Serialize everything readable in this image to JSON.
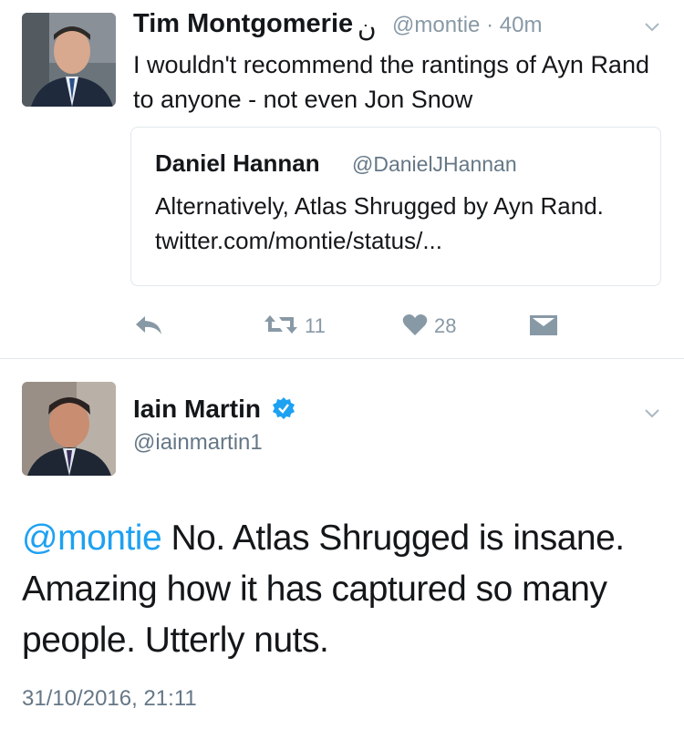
{
  "tweet1": {
    "author_name": "Tim Montgomerie",
    "name_symbol": "ن",
    "handle": "@montie",
    "separator": "·",
    "time_ago": "40m",
    "text": "I wouldn't recommend the rantings of Ayn Rand to anyone - not even Jon Snow",
    "quote": {
      "author_name": "Daniel Hannan",
      "handle": "@DanielJHannan",
      "text": "Alternatively, Atlas Shrugged by Ayn Rand. twitter.com/montie/status/..."
    },
    "actions": {
      "retweets": "11",
      "likes": "28"
    }
  },
  "tweet2": {
    "author_name": "Iain Martin",
    "handle": "@iainmartin1",
    "mention": "@montie",
    "text": " No. Atlas Shrugged is insane. Amazing how it has captured so many people. Utterly nuts.",
    "timestamp": "31/10/2016, 21:11"
  },
  "colors": {
    "link": "#1da1f2",
    "muted": "#8899a6",
    "verified": "#1da1f2",
    "border": "#e1e8ed"
  },
  "icons": [
    "chevron-down-icon",
    "reply-icon",
    "retweet-icon",
    "heart-icon",
    "direct-message-icon",
    "verified-badge-icon"
  ]
}
